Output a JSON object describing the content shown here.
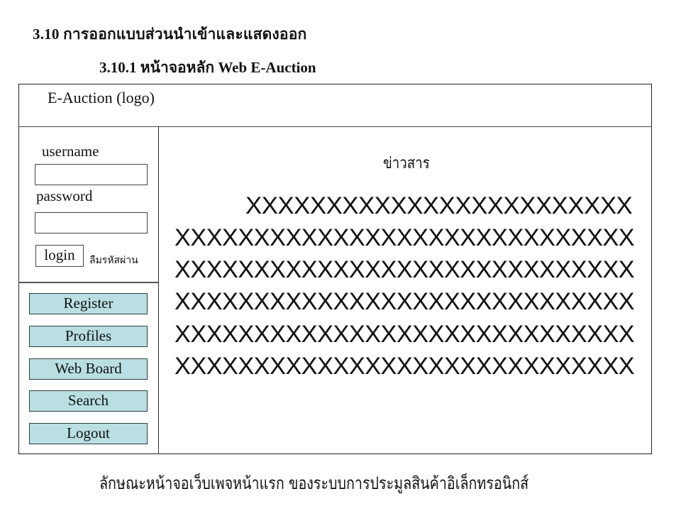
{
  "document": {
    "section_heading": "3.10  การออกแบบส่วนนำเข้าและแสดงออก",
    "subsection_heading": "3.10.1 หน้าจอหลัก Web E-Auction",
    "caption": "ลักษณะหน้าจอเว็บเพจหน้าแรก ของระบบการประมูลสินค้าอิเล็กทรอนิกส์"
  },
  "mockup": {
    "header": {
      "logo_text": "E-Auction (logo)"
    },
    "login": {
      "username_label": "username",
      "username_value": "",
      "password_label": "password",
      "password_value": "",
      "login_button": "login",
      "forgot_password_link": "ลืมรหัสผ่าน"
    },
    "menu": {
      "items": [
        {
          "label": "Register"
        },
        {
          "label": "Profiles"
        },
        {
          "label": "Web Board"
        },
        {
          "label": "Search"
        },
        {
          "label": "Logout"
        }
      ],
      "button_color": "#b9dfe2"
    },
    "news": {
      "title": "ข่าวสาร",
      "lines": [
        "XXXXXXXXXXXXXXXXXXXXXXXX",
        "XXXXXXXXXXXXXXXXXXXXXXXXXXXXX",
        "XXXXXXXXXXXXXXXXXXXXXXXXXXXXX",
        "XXXXXXXXXXXXXXXXXXXXXXXXXXXXX",
        "XXXXXXXXXXXXXXXXXXXXXXXXXXXXX",
        "XXXXXXXXXXXXXXXXXXXXXXXXXXXXX"
      ]
    }
  }
}
